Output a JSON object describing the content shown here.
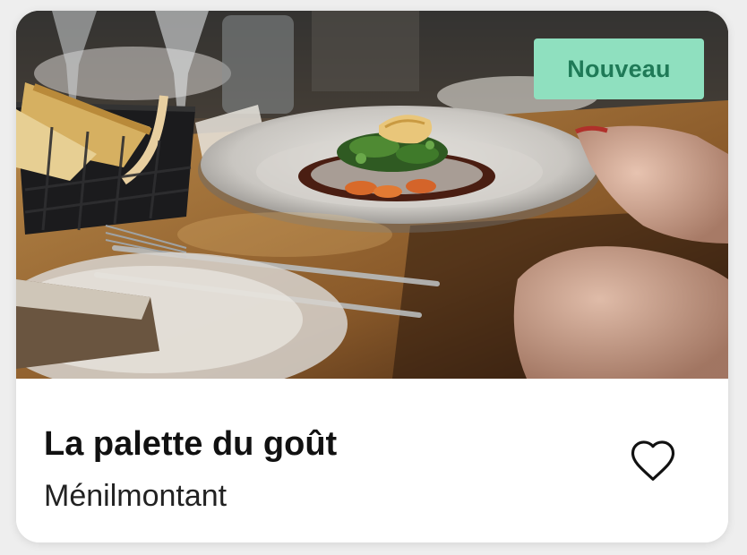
{
  "card": {
    "badge_label": "Nouveau",
    "restaurant_name": "La palette du goût",
    "neighborhood": "Ménilmontant",
    "photo_subject": "plated dish on a restaurant table",
    "favorite_icon": "heart-outline-icon",
    "favorited": false
  },
  "colors": {
    "badge_background": "#8fe0bf",
    "badge_text": "#1f7a57",
    "card_background": "#ffffff",
    "title_text": "#111111"
  }
}
